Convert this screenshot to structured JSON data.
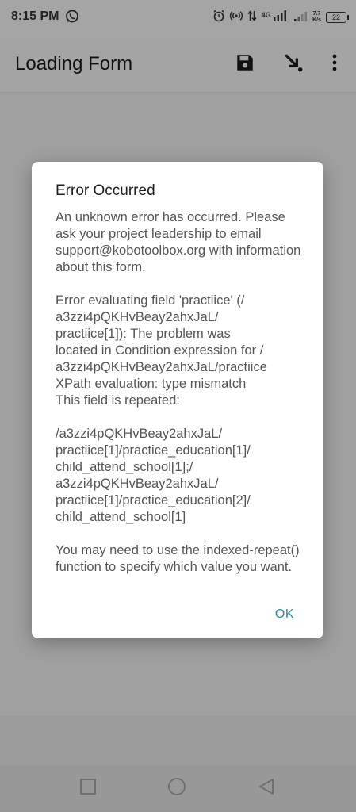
{
  "status_bar": {
    "time": "8:15 PM",
    "network_type": "4G",
    "speed_value": "7.7",
    "speed_unit": "K/s",
    "battery": "22",
    "icons": [
      "whatsapp-icon",
      "alarm-icon",
      "hotspot-icon",
      "data-transfer-icon",
      "signal-icon",
      "battery-icon"
    ]
  },
  "app_bar": {
    "title": "Loading Form",
    "actions": [
      "save-icon",
      "go-to-end-icon",
      "more-vert-icon"
    ]
  },
  "dialog": {
    "title": "Error Occurred",
    "paragraphs": [
      "An unknown error has occurred. Please ask your project leadership to email support@kobotoolbox.org with information about this form.",
      "Error evaluating field 'practiice' (/\na3zzi4pQKHvBeay2ahxJaL/\npractiice[1]): The problem was\nlocated in Condition expression for /\na3zzi4pQKHvBeay2ahxJaL/practiice\nXPath evaluation: type mismatch\nThis field is repeated:",
      "/a3zzi4pQKHvBeay2ahxJaL/\npractiice[1]/practice_education[1]/\nchild_attend_school[1];/\na3zzi4pQKHvBeay2ahxJaL/\npractiice[1]/practice_education[2]/\nchild_attend_school[1]",
      "You may need to use the indexed-repeat() function to specify which value you want."
    ],
    "ok_label": "OK"
  },
  "nav_bar": {
    "buttons": [
      "recents-icon",
      "home-icon",
      "back-icon"
    ]
  },
  "colors": {
    "accent": "#2d8a99",
    "scrim": "#a0a0a0",
    "dialog_bg": "#ffffff"
  }
}
